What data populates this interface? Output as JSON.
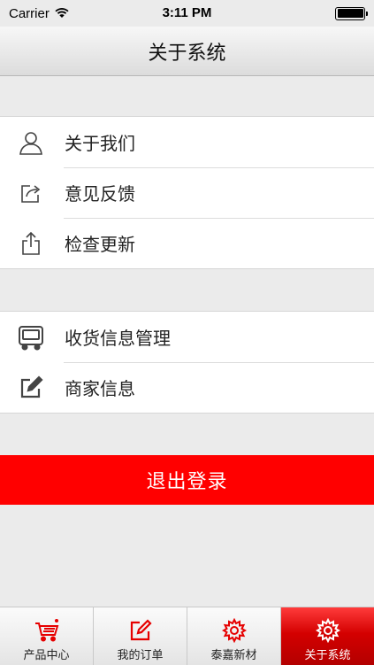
{
  "status_bar": {
    "carrier": "Carrier",
    "time": "3:11 PM"
  },
  "nav": {
    "title": "关于系统"
  },
  "group1": [
    {
      "label": "关于我们",
      "icon": "user-icon"
    },
    {
      "label": "意见反馈",
      "icon": "share-icon"
    },
    {
      "label": "检查更新",
      "icon": "upload-icon"
    }
  ],
  "group2": [
    {
      "label": "收货信息管理",
      "icon": "truck-icon"
    },
    {
      "label": "商家信息",
      "icon": "edit-icon"
    }
  ],
  "logout_label": "退出登录",
  "tabs": [
    {
      "label": "产品中心",
      "icon": "cart-icon",
      "active": false
    },
    {
      "label": "我的订单",
      "icon": "pencil-icon",
      "active": false
    },
    {
      "label": "泰嘉新材",
      "icon": "gear-icon",
      "active": false
    },
    {
      "label": "关于系统",
      "icon": "gear-icon",
      "active": true
    }
  ],
  "colors": {
    "accent": "#ff0000",
    "active_tab": "#d40000"
  }
}
